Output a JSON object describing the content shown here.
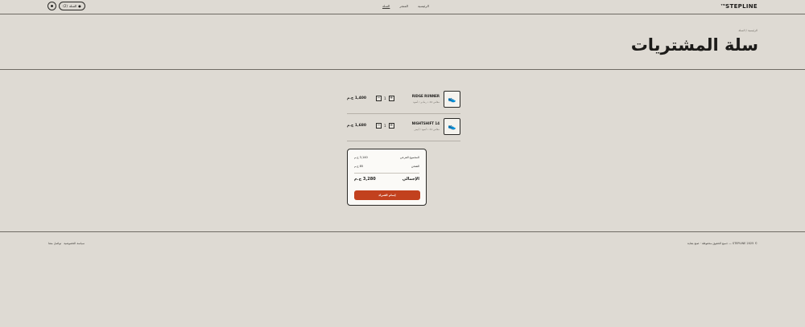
{
  "header": {
    "logo": "STEPLINE",
    "logo_prefix": "TM",
    "nav": [
      {
        "label": "الرئيسية",
        "active": false
      },
      {
        "label": "المتجر",
        "active": false
      },
      {
        "label": "السلة",
        "active": true
      }
    ],
    "cart_label": "السلة",
    "cart_count": "(2)",
    "theme_icon": "theme-toggle-icon"
  },
  "breadcrumb": "الرئيسية / السلة",
  "page_title": "سلة المشتريات",
  "items": [
    {
      "name": "RIDGE RUNNER",
      "meta": "مقاس 42 • رمادي / أسود",
      "qty": "1",
      "minus": "−",
      "plus": "+",
      "price": "1,400 ج.م",
      "icon": "shoe-icon"
    },
    {
      "name": "NIGHTSHIFT 14",
      "meta": "مقاس 41 • أسود / أبيض",
      "qty": "1",
      "minus": "−",
      "plus": "+",
      "price": "1,680 ج.م",
      "icon": "shoe-icon"
    }
  ],
  "summary": {
    "subtotal_label": "المجموع الفرعي",
    "subtotal_value": "3,140 ج.م",
    "shipping_label": "الشحن",
    "shipping_value": "85 ج.م",
    "total_label": "الإجمالي",
    "total_value": "3,280 ج.م",
    "checkout_label": "إتمام الشراء"
  },
  "footer": {
    "left_links": [
      "سياسة الخصوصية",
      "تواصل معنا"
    ],
    "copyright": "© STEPLINE 2025 — جميع الحقوق محفوظة · صنع بعناية"
  },
  "colors": {
    "background": "#dedad3",
    "accent": "#c2411e",
    "card": "#fbfaf7"
  }
}
